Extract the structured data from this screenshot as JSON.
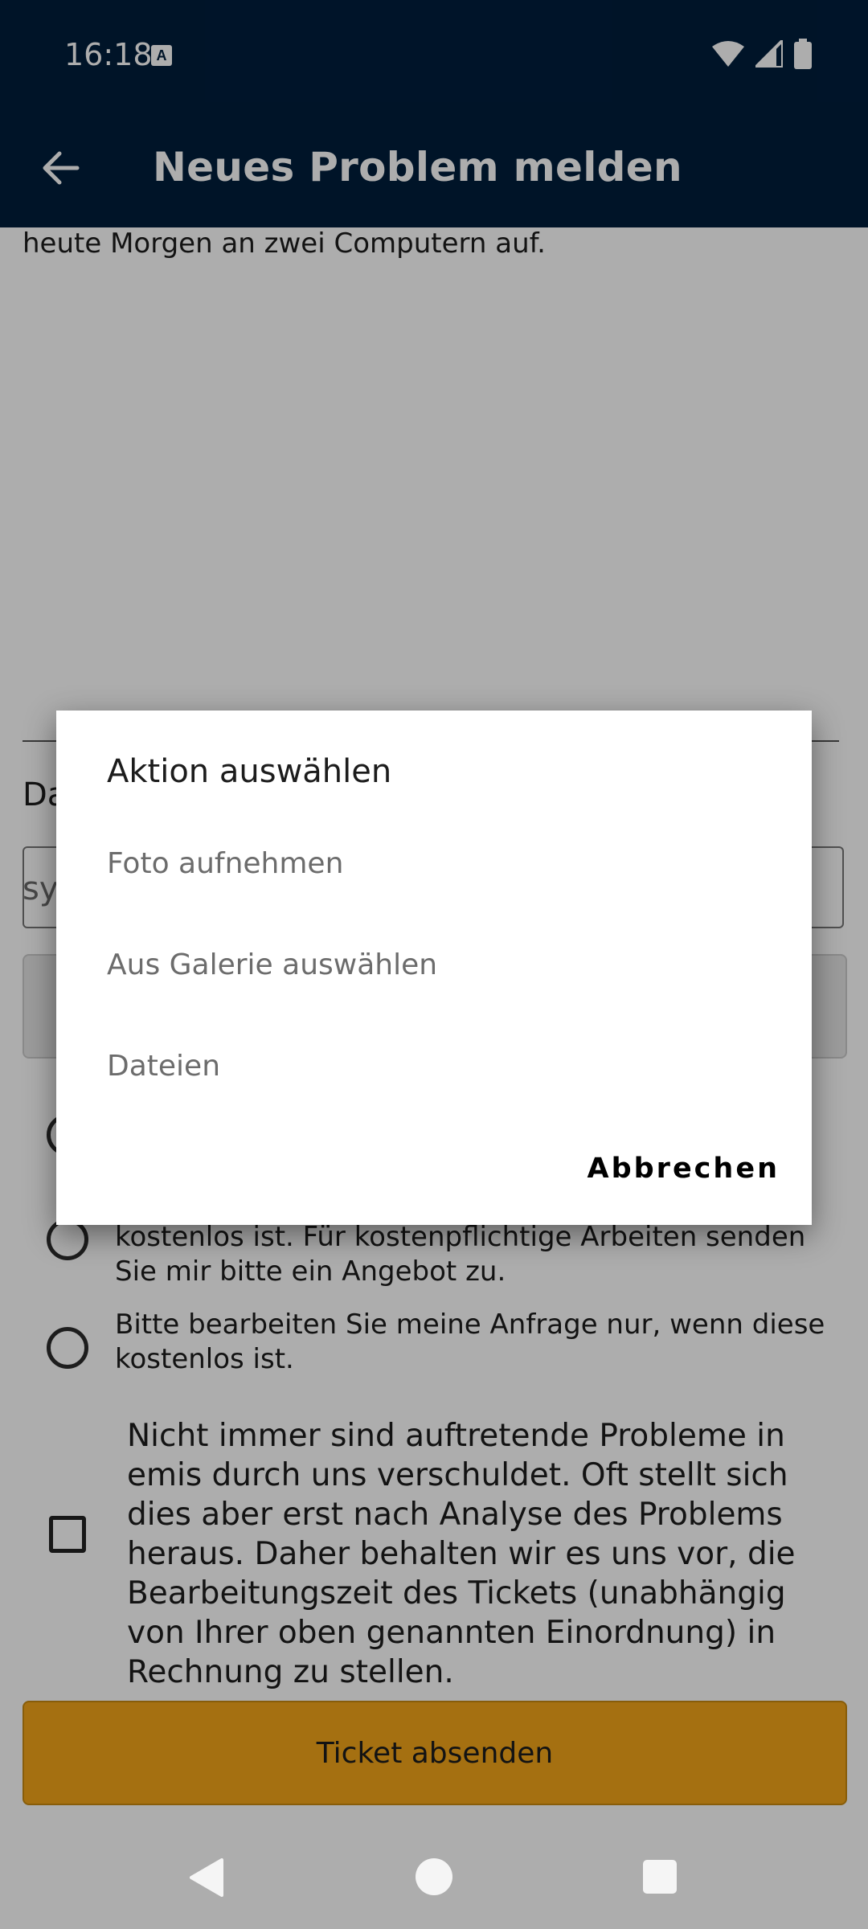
{
  "status_bar": {
    "time": "16:18",
    "notification_badge": "A",
    "icons": [
      "wifi-icon",
      "signal-icon",
      "battery-icon"
    ]
  },
  "app_bar": {
    "title": "Neues Problem melden",
    "back_icon": "arrow-left-icon"
  },
  "form": {
    "description_tail": "heute Morgen an zwei Computern auf.",
    "date_label_partial": "Da",
    "date_placeholder_partial": "sy",
    "radio_options": [
      "kostenlos ist. Für kostenpflichtige Arbeiten senden Sie mir bitte ein Angebot zu.",
      "Bitte bearbeiten Sie meine Anfrage nur, wenn diese kostenlos ist."
    ],
    "disclaimer": "Nicht immer sind auftretende Probleme in emis durch uns verschuldet. Oft stellt sich dies aber erst nach Analyse des Problems heraus. Daher behalten wir es uns vor, die Bearbeitungszeit des Tickets (unabhängig von Ihrer oben genannten Einordnung) in Rechnung zu stellen.",
    "submit_label": "Ticket absenden",
    "submit_color": "#f4a51a"
  },
  "dialog": {
    "title": "Aktion auswählen",
    "items": [
      "Foto aufnehmen",
      "Aus Galerie auswählen",
      "Dateien"
    ],
    "cancel_label": "Abbrechen"
  },
  "nav": {
    "icons": [
      "nav-back-icon",
      "nav-home-icon",
      "nav-recents-icon"
    ]
  },
  "colors": {
    "primary": "#001e3c",
    "accent": "#f4a51a"
  }
}
